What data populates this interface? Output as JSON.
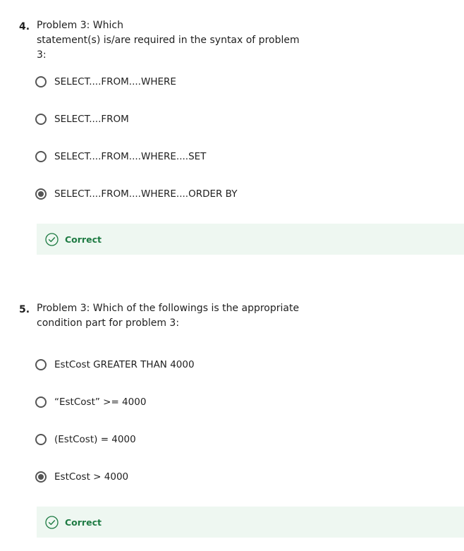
{
  "questions": [
    {
      "number": "4.",
      "text": "Problem 3: Which\nstatement(s) is/are required in the syntax of problem 3:",
      "options": [
        {
          "label": "SELECT....FROM....WHERE",
          "selected": false
        },
        {
          "label": "SELECT....FROM",
          "selected": false
        },
        {
          "label": "SELECT....FROM....WHERE....SET",
          "selected": false
        },
        {
          "label": "SELECT....FROM....WHERE....ORDER BY",
          "selected": true
        }
      ],
      "feedback": "Correct"
    },
    {
      "number": "5.",
      "text": "Problem 3: Which of the followings is the appropriate\ncondition part for problem 3:",
      "options": [
        {
          "label": "EstCost GREATER THAN 4000",
          "selected": false
        },
        {
          "label": "“EstCost” >= 4000",
          "selected": false
        },
        {
          "label": "(EstCost) = 4000",
          "selected": false
        },
        {
          "label": "EstCost > 4000",
          "selected": true
        }
      ],
      "feedback": "Correct"
    }
  ],
  "colors": {
    "feedback_bg": "#eef7f1",
    "correct_green": "#1e7b43",
    "radio_border": "#555555"
  },
  "icons": {
    "feedback_icon": "check-circle-icon"
  }
}
